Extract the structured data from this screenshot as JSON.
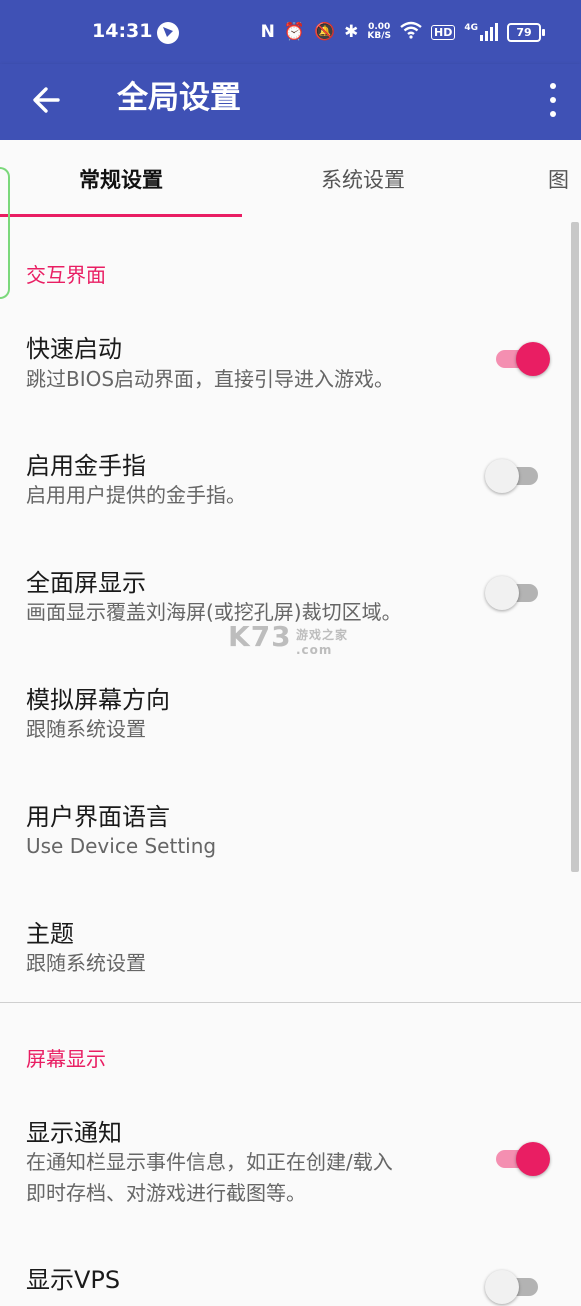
{
  "status_bar": {
    "time": "14:31",
    "net_speed_top": "0.00",
    "net_speed_bottom": "KB/S",
    "hd": "HD",
    "signal_label": "4G",
    "battery": "79"
  },
  "app_bar": {
    "title": "全局设置"
  },
  "tabs": [
    {
      "label": "常规设置"
    },
    {
      "label": "系统设置"
    },
    {
      "label": "图"
    }
  ],
  "sections": [
    {
      "header": "交互界面",
      "items": [
        {
          "title": "快速启动",
          "summary": "跳过BIOS启动界面，直接引导进入游戏。",
          "switch": true
        },
        {
          "title": "启用金手指",
          "summary": "启用用户提供的金手指。",
          "switch": false
        },
        {
          "title": "全面屏显示",
          "summary": "画面显示覆盖刘海屏(或挖孔屏)裁切区域。",
          "switch": false
        },
        {
          "title": "模拟屏幕方向",
          "summary": "跟随系统设置"
        },
        {
          "title": "用户界面语言",
          "summary": "Use Device Setting"
        },
        {
          "title": "主题",
          "summary": "跟随系统设置"
        }
      ]
    },
    {
      "header": "屏幕显示",
      "items": [
        {
          "title": "显示通知",
          "summary_line1": "在通知栏显示事件信息，如正在创建/载入",
          "summary_line2": "即时存档、对游戏进行截图等。",
          "switch": true
        },
        {
          "title": "显示VPS"
        }
      ]
    }
  ],
  "watermark": {
    "main": "K73",
    "sub": "游戏之家",
    "domain": ".com"
  },
  "colors": {
    "primary": "#3f51b5",
    "accent": "#e91e63",
    "accent_track": "#f48fb1"
  }
}
